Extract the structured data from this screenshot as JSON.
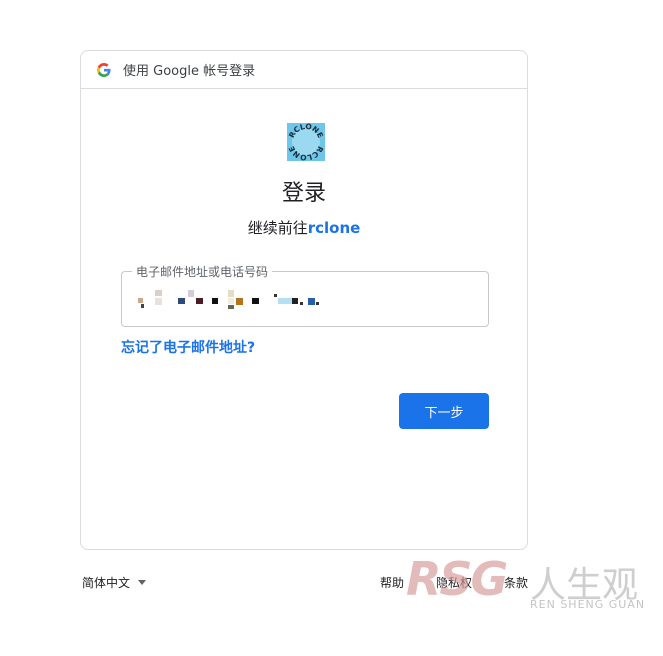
{
  "header": {
    "text": "使用 Google 帐号登录",
    "icon": "google-g-icon"
  },
  "app": {
    "logo_text": "RCLONE",
    "logo_icon": "rclone-logo-icon",
    "name": "rclone"
  },
  "main": {
    "title": "登录",
    "subtitle_prefix": "继续前往"
  },
  "form": {
    "email_label": "电子邮件地址或电话号码",
    "forgot_link": "忘记了电子邮件地址?",
    "next_button": "下一步"
  },
  "footer": {
    "language": "简体中文",
    "help": "帮助",
    "privacy": "隐私权",
    "terms": "条款"
  },
  "watermark": {
    "brand": "RSG",
    "cn": "人生观",
    "en": "REN SHENG GUAN"
  },
  "colors": {
    "accent": "#1a73e8",
    "border": "#dadce0"
  }
}
